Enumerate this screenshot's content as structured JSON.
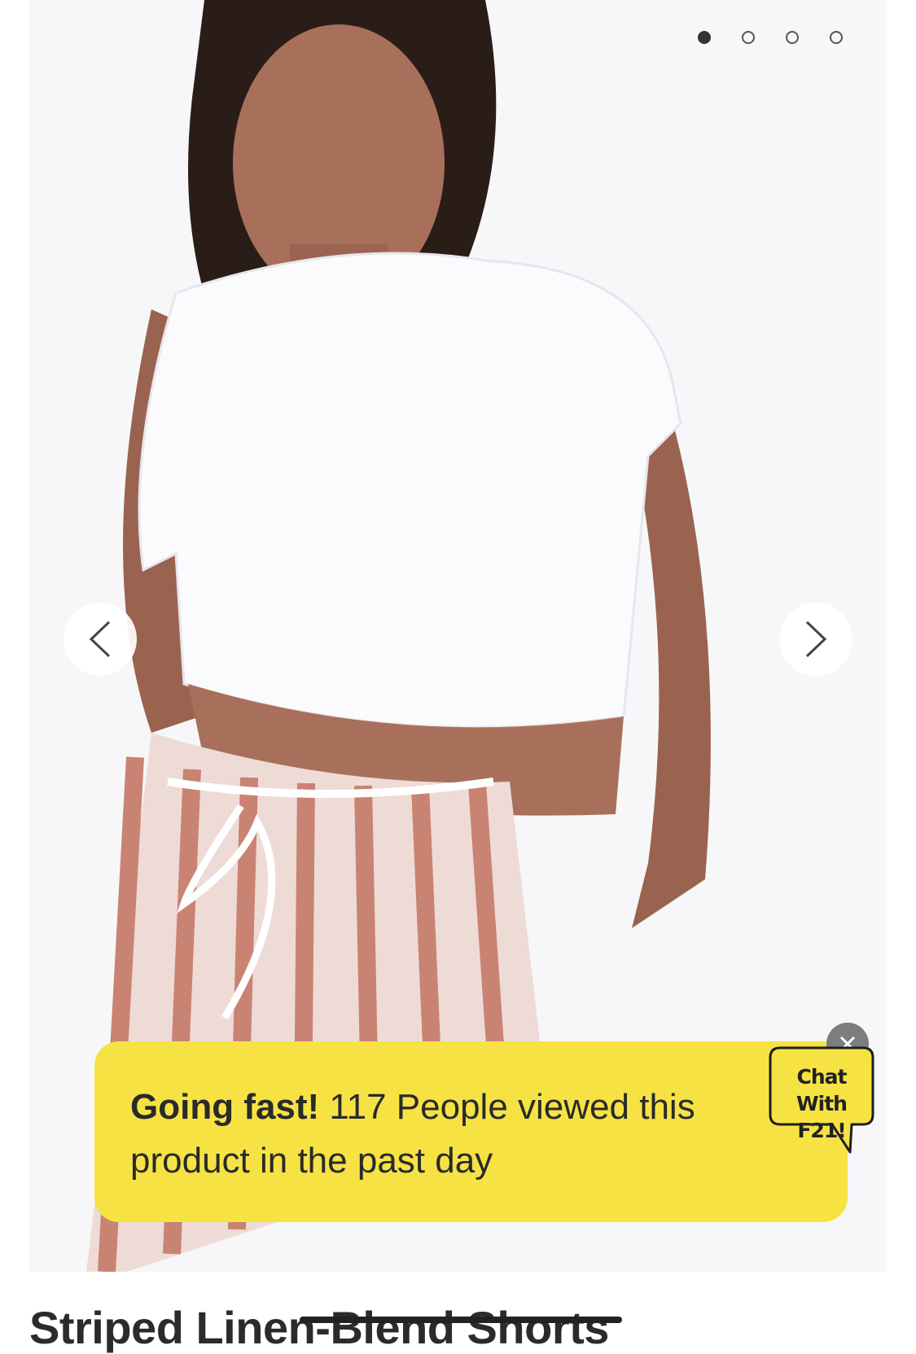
{
  "carousel": {
    "image_alt": "",
    "slide_count": 4,
    "active_index": 0
  },
  "urgency": {
    "strong_text": "Going fast!",
    "rest_text": " 117 People viewed this product in the past day"
  },
  "chat": {
    "line1": "Chat With",
    "line2": "F21!"
  },
  "product": {
    "title": "Striped Linen-Blend Shorts"
  },
  "colors": {
    "banner": "#f6e343",
    "close_badge": "#7d7d7d"
  }
}
